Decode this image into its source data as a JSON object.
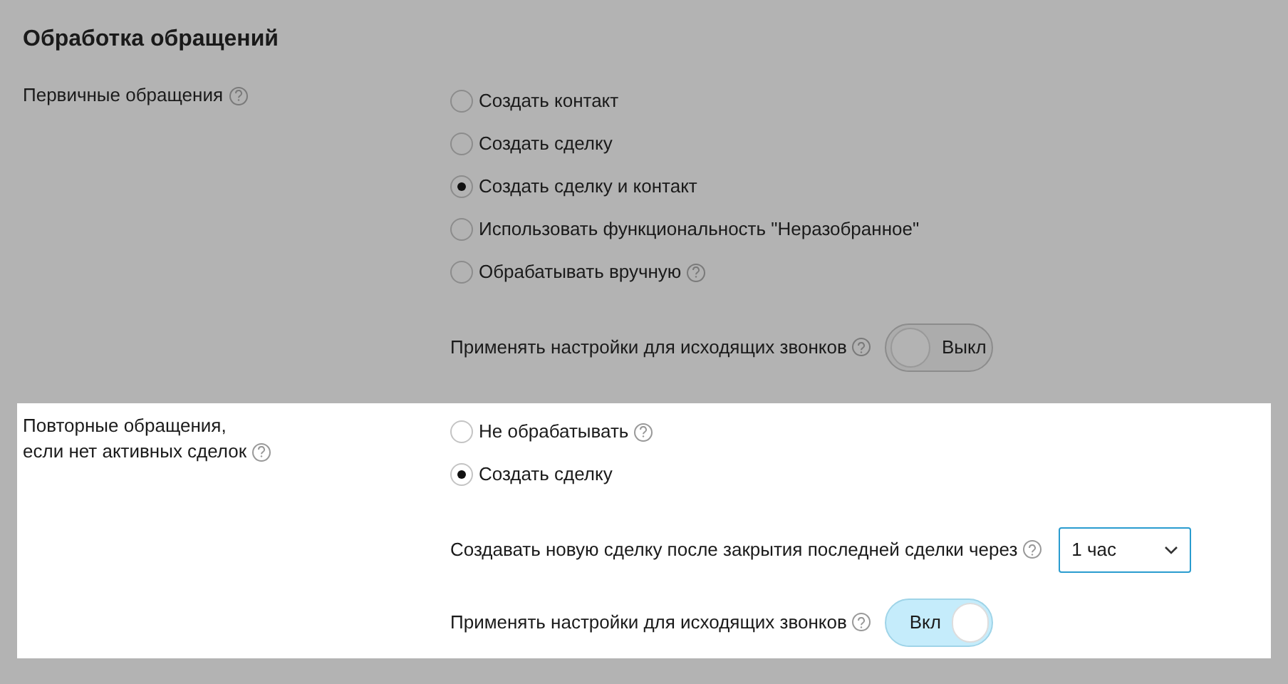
{
  "title": "Обработка обращений",
  "sections": [
    {
      "label_lines": [
        "Первичные обращения"
      ],
      "label_help": true,
      "highlighted": false,
      "options": [
        {
          "label": "Создать контакт",
          "selected": false,
          "help": false
        },
        {
          "label": "Создать сделку",
          "selected": false,
          "help": false
        },
        {
          "label": "Создать сделку и контакт",
          "selected": true,
          "help": false
        },
        {
          "label": "Использовать функциональность \"Неразобранное\"",
          "selected": false,
          "help": false
        },
        {
          "label": "Обрабатывать вручную",
          "selected": false,
          "help": true
        }
      ],
      "settings": [
        {
          "kind": "toggle",
          "label": "Применять настройки для исходящих звонков",
          "on": false,
          "value": "Выкл"
        }
      ]
    },
    {
      "label_lines": [
        "Повторные обращения,",
        "если нет активных сделок"
      ],
      "label_help": true,
      "highlighted": true,
      "options": [
        {
          "label": "Не обрабатывать",
          "selected": false,
          "help": true
        },
        {
          "label": "Создать сделку",
          "selected": true,
          "help": false
        }
      ],
      "settings": [
        {
          "kind": "select",
          "label": "Создавать новую сделку после закрытия последней сделки через",
          "value": "1 час"
        },
        {
          "kind": "toggle",
          "label": "Применять настройки для исходящих звонков",
          "on": true,
          "value": "Вкл"
        }
      ]
    }
  ]
}
